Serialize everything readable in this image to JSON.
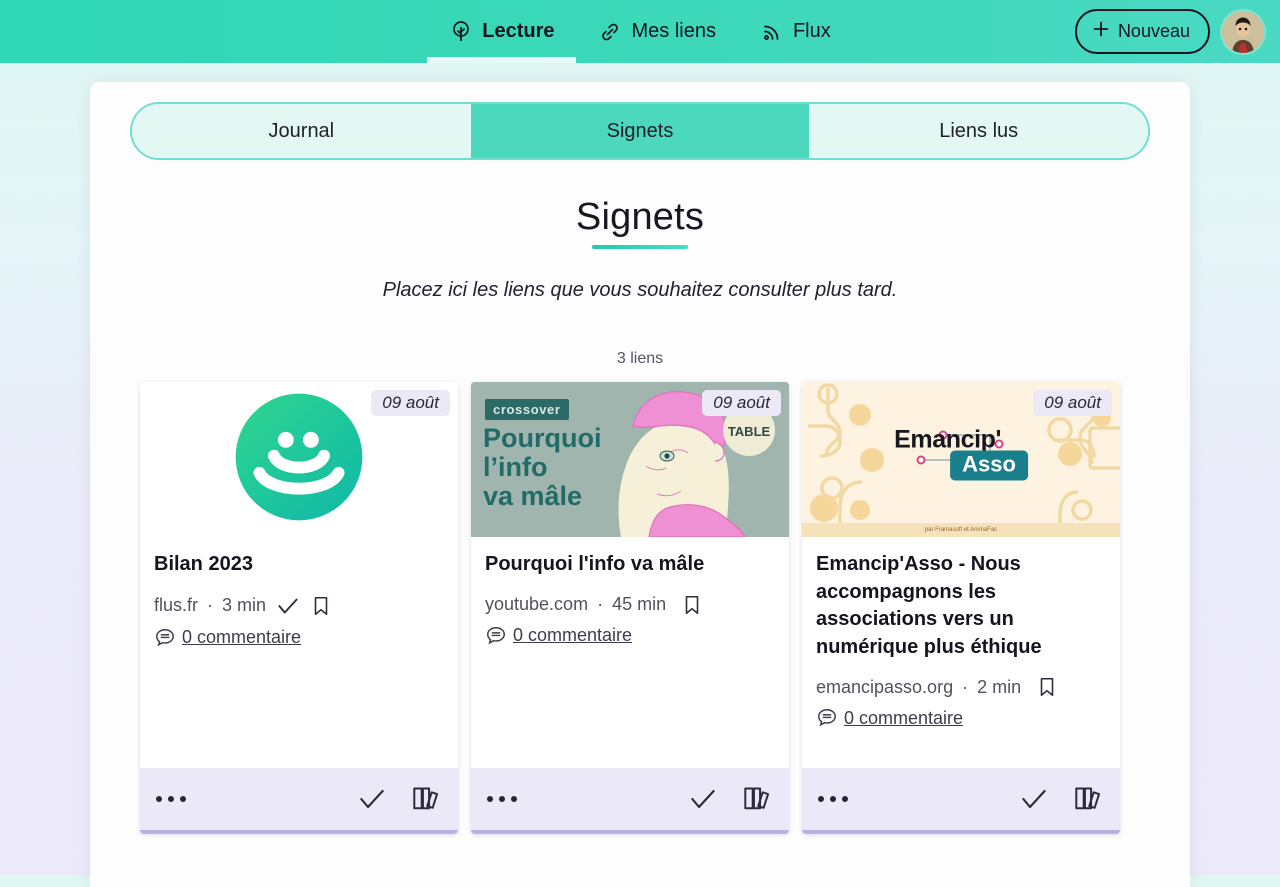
{
  "topbar": {
    "nav": [
      {
        "label": "Lecture",
        "icon": "tree-icon",
        "active": true
      },
      {
        "label": "Mes liens",
        "icon": "link-icon",
        "active": false
      },
      {
        "label": "Flux",
        "icon": "rss-icon",
        "active": false
      }
    ],
    "new_button": {
      "label": "Nouveau",
      "icon": "plus-icon"
    },
    "avatar": {
      "alt": "avatar"
    },
    "accent": "#2fd7b4"
  },
  "tabs": [
    {
      "label": "Journal",
      "selected": false
    },
    {
      "label": "Signets",
      "selected": true
    },
    {
      "label": "Liens lus",
      "selected": false
    }
  ],
  "page": {
    "title": "Signets",
    "subtitle": "Placez ici les liens que vous souhaitez consulter plus tard.",
    "count": "3 liens",
    "accent": "#25c8a8",
    "badge_bg": "#ece9f7",
    "footer_bg": "#ebe8f8",
    "card_border": "#b9b1e3"
  },
  "cards": [
    {
      "date": "09 août",
      "title": "Bilan 2023",
      "source": "flus.fr",
      "duration": "3 min",
      "separator": "·",
      "has_check_inline": true,
      "has_bookmark_inline": true,
      "comments": "0 commentaire",
      "thumb": "flus-smiley-logo",
      "footer": {
        "menu": "more-options",
        "check": "mark-as-read",
        "library": "add-to-library"
      }
    },
    {
      "date": "09 août",
      "title": "Pourquoi l'info va mâle",
      "source": "youtube.com",
      "duration": "45 min",
      "separator": "·",
      "has_check_inline": false,
      "has_bookmark_inline": true,
      "comments": "0 commentaire",
      "thumb": "crossover-video-thumbnail",
      "thumb_badge": "crossover",
      "thumb_line1": "Pourquoi",
      "thumb_line2": "l’info",
      "thumb_line3": "va mâle",
      "footer": {
        "menu": "more-options",
        "check": "mark-as-read",
        "library": "add-to-library"
      }
    },
    {
      "date": "09 août",
      "title": "Emancip'Asso - Nous accompagnons les associations vers un numérique plus éthique",
      "source": "emancipasso.org",
      "duration": "2 min",
      "separator": "·",
      "has_check_inline": false,
      "has_bookmark_inline": true,
      "comments": "0 commentaire",
      "thumb": "emancipasso-logo-thumbnail",
      "thumb_word": "Emancip'",
      "thumb_word2": "Asso",
      "thumb_strip": "par Framasoft et AnimaFac",
      "footer": {
        "menu": "more-options",
        "check": "mark-as-read",
        "library": "add-to-library"
      }
    }
  ]
}
